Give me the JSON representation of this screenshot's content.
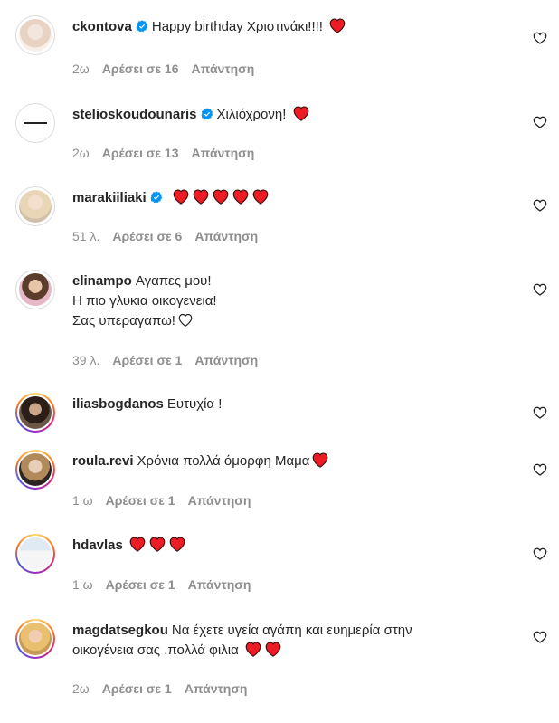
{
  "comments": [
    {
      "username": "ckontova",
      "verified": true,
      "text": "Happy birthday Χριστινάκι!!!!",
      "hearts": 1,
      "time": "2ω",
      "likes": "Αρέσει σε 16",
      "reply": "Απάντηση"
    },
    {
      "username": "stelioskoudounaris",
      "verified": true,
      "text": "Χιλιόχρονη!",
      "hearts": 1,
      "time": "2ω",
      "likes": "Αρέσει σε 13",
      "reply": "Απάντηση"
    },
    {
      "username": "marakiiliaki",
      "verified": true,
      "text": "",
      "hearts": 5,
      "time": "51 λ.",
      "likes": "Αρέσει σε 6",
      "reply": "Απάντηση"
    },
    {
      "username": "elinampo",
      "verified": false,
      "lines": [
        "Αγαπες μου!",
        "Η πιο γλυκια οικογενεια!",
        "Σας υπεραγαπω!"
      ],
      "outline_heart": true,
      "time": "39 λ.",
      "likes": "Αρέσει σε 1",
      "reply": "Απάντηση"
    },
    {
      "username": "iliasbogdanos",
      "verified": false,
      "text": "Ευτυχία !",
      "hearts": 0,
      "time": "",
      "likes": "",
      "reply": ""
    },
    {
      "username": "roula.revi",
      "verified": false,
      "text": "Χρόνια πολλά όμορφη Μαμα",
      "hearts": 1,
      "time": "1 ω",
      "likes": "Αρέσει σε 1",
      "reply": "Απάντηση"
    },
    {
      "username": "hdavlas",
      "verified": false,
      "text": "",
      "hearts": 3,
      "time": "1 ω",
      "likes": "Αρέσει σε 1",
      "reply": "Απάντηση"
    },
    {
      "username": "magdatsegkou",
      "verified": false,
      "lines": [
        "Να έχετε υγεία αγάπη και ευημερία στην",
        "οικογένεια σας .πολλά φιλια"
      ],
      "hearts": 2,
      "time": "2ω",
      "likes": "Αρέσει σε 1",
      "reply": "Απάντηση"
    }
  ],
  "icons": {
    "like": "heart-outline-icon",
    "verified": "verified-badge-icon",
    "heart_emoji": "red-heart-emoji"
  },
  "colors": {
    "verified": "#0095f6",
    "heart": "#ed1c24",
    "meta": "#8e8e8e",
    "text": "#262626"
  }
}
